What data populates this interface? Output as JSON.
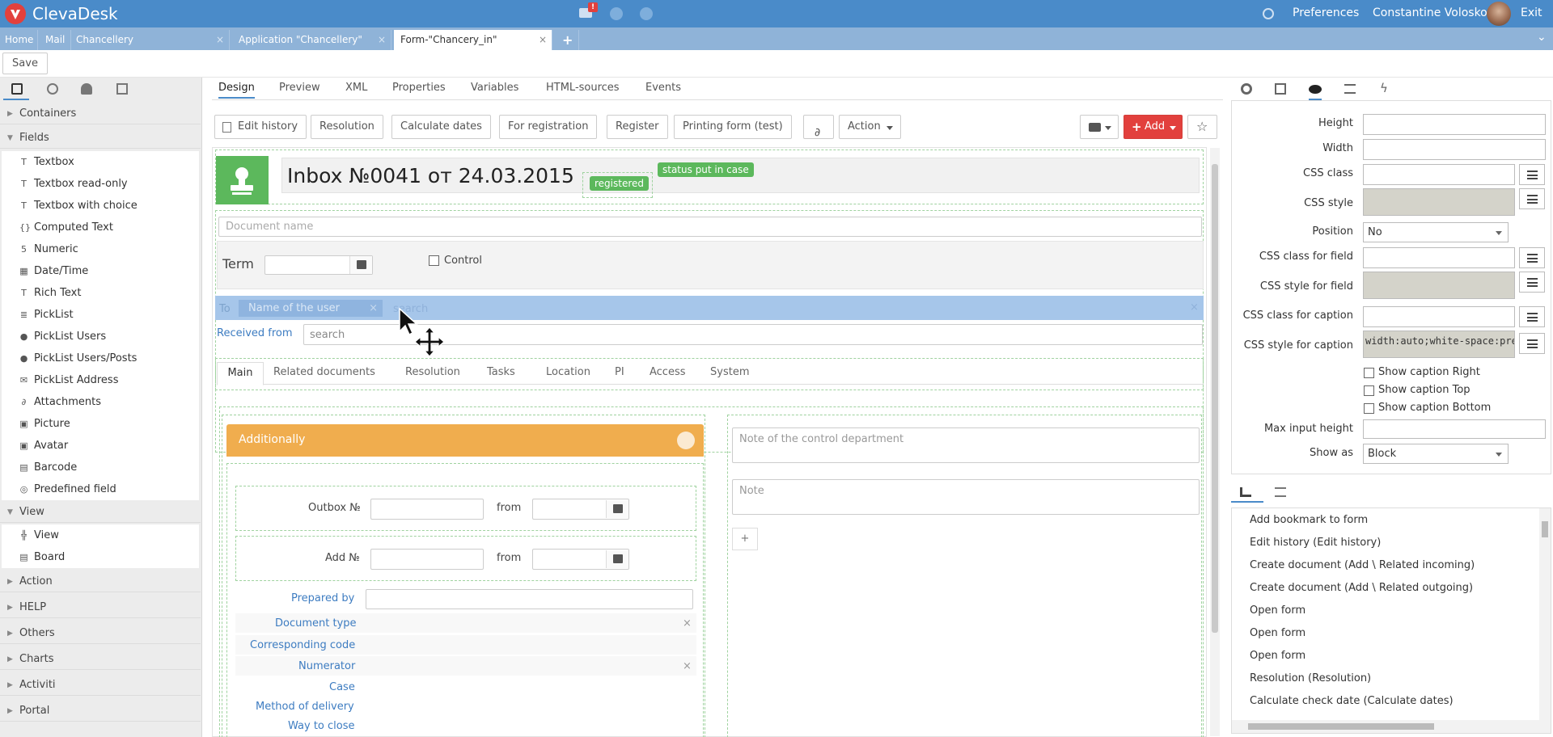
{
  "app": {
    "name": "ClevaDesk",
    "mail_badge": "!"
  },
  "topbar": {
    "preferences": "Preferences",
    "user": "Constantine Voloskov",
    "exit": "Exit"
  },
  "tabs": [
    {
      "label": "Home"
    },
    {
      "label": "Mail"
    },
    {
      "label": "Chancellery",
      "close": "×"
    },
    {
      "label": "Application \"Chancellery\"",
      "close": "×"
    },
    {
      "label": "Form-\"Chancery_in\"",
      "close": "×"
    }
  ],
  "tab_add": "+",
  "tab_collapse": "⌄",
  "toolbar": {
    "save": "Save"
  },
  "left": {
    "sections": {
      "containers": "Containers",
      "fields": "Fields",
      "view": "View",
      "action": "Action",
      "help": "HELP",
      "others": "Others",
      "charts": "Charts",
      "activiti": "Activiti",
      "portal": "Portal"
    },
    "fields": [
      {
        "label": "Textbox",
        "icon": "T"
      },
      {
        "label": "Textbox read-only",
        "icon": "T"
      },
      {
        "label": "Textbox with choice",
        "icon": "T"
      },
      {
        "label": "Computed Text",
        "icon": "{}"
      },
      {
        "label": "Numeric",
        "icon": "5"
      },
      {
        "label": "Date/Time",
        "icon": "▦"
      },
      {
        "label": "Rich Text",
        "icon": "T"
      },
      {
        "label": "PickList",
        "icon": "≣"
      },
      {
        "label": "PickList Users",
        "icon": "●"
      },
      {
        "label": "PickList Users/Posts",
        "icon": "●"
      },
      {
        "label": "PickList Address",
        "icon": "✉"
      },
      {
        "label": "Attachments",
        "icon": "∂"
      },
      {
        "label": "Picture",
        "icon": "▣"
      },
      {
        "label": "Avatar",
        "icon": "▣"
      },
      {
        "label": "Barcode",
        "icon": "▤"
      },
      {
        "label": "Predefined field",
        "icon": "◎"
      }
    ],
    "view_items": [
      {
        "label": "View",
        "icon": "╬"
      },
      {
        "label": "Board",
        "icon": "▤"
      }
    ]
  },
  "center": {
    "tabs": [
      "Design",
      "Preview",
      "XML",
      "Properties",
      "Variables",
      "HTML-sources",
      "Events"
    ],
    "buttons": {
      "edit_history": "Edit history",
      "resolution": "Resolution",
      "calculate_dates": "Calculate dates",
      "for_registration": "For registration",
      "register": "Register",
      "printing_form": "Printing form (test)",
      "action": "Action",
      "add": "Add"
    },
    "form": {
      "title": "Inbox №0041 от 24.03.2015",
      "badge_registered": "registered",
      "badge_status": "status put in case",
      "doc_name_placeholder": "Document name",
      "term_label": "Term",
      "control_label": "Control",
      "to_label": "To",
      "to_chip": "Name of the user",
      "to_search": "search",
      "received_from": "Received from",
      "received_placeholder": "search",
      "subtabs": [
        "Main",
        "Related documents",
        "Resolution",
        "Tasks",
        "Location",
        "PI",
        "Access",
        "System"
      ],
      "additionally": "Additionally",
      "outbox_label": "Outbox №",
      "from_label": "from",
      "add_no_label": "Add №",
      "prepared_by": "Prepared by",
      "document_type": "Document type",
      "corresponding_code": "Corresponding code",
      "numerator": "Numerator",
      "case": "Case",
      "method_of_delivery": "Method of delivery",
      "way_to_close": "Way to close",
      "note_control_placeholder": "Note of the control department",
      "note_placeholder": "Note",
      "plus": "+",
      "clear": "×"
    }
  },
  "props": {
    "height": "Height",
    "width": "Width",
    "css_class": "CSS class",
    "css_style": "CSS style",
    "position": "Position",
    "position_value": "No",
    "css_class_field": "CSS class for field",
    "css_style_field": "CSS style for field",
    "css_class_caption": "CSS class for caption",
    "css_style_caption": "CSS style for caption",
    "css_style_caption_value": "width:auto;white-space:pre",
    "show_caption_right": "Show caption Right",
    "show_caption_top": "Show caption Top",
    "show_caption_bottom": "Show caption Bottom",
    "max_input_height": "Max input height",
    "show_as": "Show as",
    "show_as_value": "Block"
  },
  "actions": [
    "Add bookmark to form",
    "Edit history (Edit history)",
    "Create document (Add \\ Related incoming)",
    "Create document (Add \\ Related outgoing)",
    "Open form",
    "Open form",
    "Open form",
    "Resolution (Resolution)",
    "Calculate check date (Calculate dates)"
  ],
  "colors": {
    "topbar": "#4a8bc9",
    "accent_red": "#e2403d",
    "green": "#5cb85c",
    "orange": "#f0ad4e",
    "highlight": "#a6c6ea"
  }
}
